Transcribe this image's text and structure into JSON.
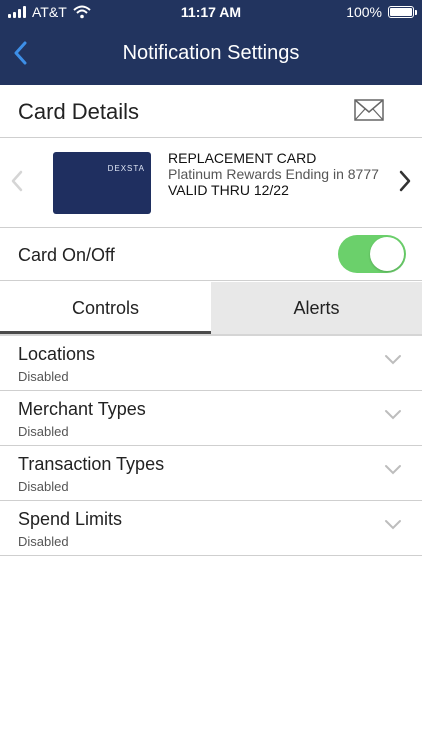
{
  "status_bar": {
    "carrier": "AT&T",
    "time": "11:17 AM",
    "battery": "100%"
  },
  "nav": {
    "title": "Notification Settings"
  },
  "card_section": {
    "title": "Card Details",
    "card": {
      "brand": "DEXSTA",
      "name": "REPLACEMENT CARD",
      "description": "Platinum Rewards Ending in 8777",
      "valid": "VALID THRU 12/22"
    }
  },
  "toggle": {
    "label": "Card On/Off",
    "state": "on"
  },
  "tabs": [
    {
      "label": "Controls",
      "active": true
    },
    {
      "label": "Alerts",
      "active": false
    }
  ],
  "controls": [
    {
      "title": "Locations",
      "status": "Disabled"
    },
    {
      "title": "Merchant Types",
      "status": "Disabled"
    },
    {
      "title": "Transaction Types",
      "status": "Disabled"
    },
    {
      "title": "Spend Limits",
      "status": "Disabled"
    }
  ],
  "colors": {
    "header_bg": "#22345f",
    "back_arrow": "#3d8fe8",
    "toggle_on": "#6bd06b",
    "card_bg": "#1f2f60"
  }
}
